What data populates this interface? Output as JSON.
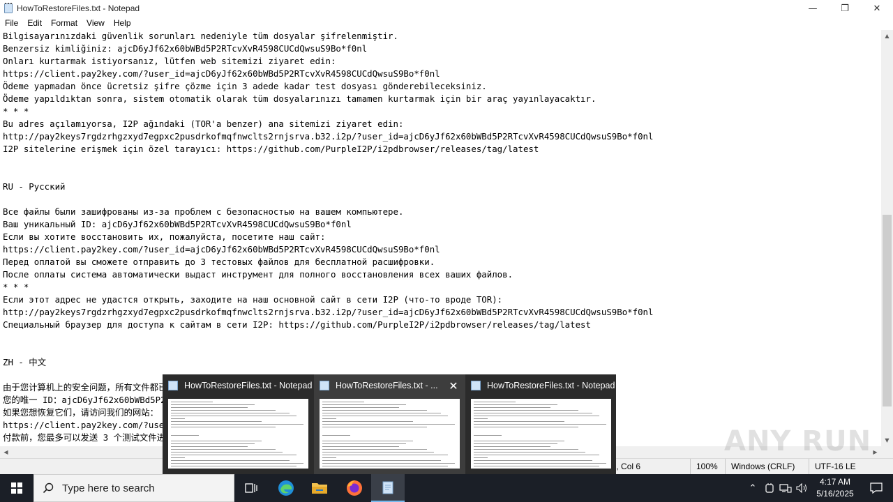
{
  "window": {
    "title": "HowToRestoreFiles.txt - Notepad",
    "minimize_glyph": "—",
    "maximize_glyph": "❐",
    "close_glyph": "✕"
  },
  "menu": [
    "File",
    "Edit",
    "Format",
    "View",
    "Help"
  ],
  "editor_lines": [
    "Bilgisayarınızdaki güvenlik sorunları nedeniyle tüm dosyalar şifrelenmiştir.",
    "Benzersiz kimliğiniz: ajcD6yJf62x60bWBd5P2RTcvXvR4598CUCdQwsuS9Bo*f0nl",
    "Onları kurtarmak istiyorsanız, lütfen web sitemizi ziyaret edin:",
    "https://client.pay2key.com/?user_id=ajcD6yJf62x60bWBd5P2RTcvXvR4598CUCdQwsuS9Bo*f0nl",
    "Ödeme yapmadan önce ücretsiz şifre çözme için 3 adede kadar test dosyası gönderebileceksiniz.",
    "Ödeme yapıldıktan sonra, sistem otomatik olarak tüm dosyalarınızı tamamen kurtarmak için bir araç yayınlayacaktır.",
    "* * *",
    "Bu adres açılamıyorsa, I2P ağındaki (TOR'a benzer) ana sitemizi ziyaret edin:",
    "http://pay2keys7rgdzrhgzxyd7egpxc2pusdrkofmqfnwclts2rnjsrva.b32.i2p/?user_id=ajcD6yJf62x60bWBd5P2RTcvXvR4598CUCdQwsuS9Bo*f0nl",
    "I2P sitelerine erişmek için özel tarayıcı: https://github.com/PurpleI2P/i2pdbrowser/releases/tag/latest",
    "",
    "",
    "RU - Русский",
    "",
    "Все файлы были зашифрованы из-за проблем с безопасностью на вашем компьютере.",
    "Ваш уникальный ID: ajcD6yJf62x60bWBd5P2RTcvXvR4598CUCdQwsuS9Bo*f0nl",
    "Если вы хотите восстановить их, пожалуйста, посетите наш сайт:",
    "https://client.pay2key.com/?user_id=ajcD6yJf62x60bWBd5P2RTcvXvR4598CUCdQwsuS9Bo*f0nl",
    "Перед оплатой вы сможете отправить до 3 тестовых файлов для бесплатной расшифровки.",
    "После оплаты система автоматически выдаст инструмент для полного восстановления всех ваших файлов.",
    "* * *",
    "Если этот адрес не удастся открыть, заходите на наш основной сайт в сети I2P (что-то вроде TOR):",
    "http://pay2keys7rgdzrhgzxyd7egpxc2pusdrkofmqfnwclts2rnjsrva.b32.i2p/?user_id=ajcD6yJf62x60bWBd5P2RTcvXvR4598CUCdQwsuS9Bo*f0nl",
    "Специальный браузер для доступа к сайтам в сети I2P: https://github.com/PurpleI2P/i2pdbrowser/releases/tag/latest",
    "",
    "",
    "ZH - 中文",
    "",
    "由于您计算机上的安全问题，所有文件都已加密。",
    "您的唯一 ID：ajcD6yJf62x60bWBd5P2RTcvXvR4598CUCdQwsuS9Bo*f0nl",
    "如果您想恢复它们，请访问我们的网站：",
    "https://client.pay2key.com/?user_id=ajcD6yJf62x60bWBd5P2RTcvXvR4598CUCdQwsuS9Bo*f0nl",
    "付款前，您最多可以发送 3 个测试文件进行免费解密。"
  ],
  "status": {
    "position": "Ln 6, Col 6",
    "zoom": "100%",
    "line_endings": "Windows (CRLF)",
    "encoding": "UTF-16 LE"
  },
  "watermark": "ANY RUN",
  "thumbnails": [
    {
      "title": "HowToRestoreFiles.txt - Notepad"
    },
    {
      "title": "HowToRestoreFiles.txt - ..."
    },
    {
      "title": "HowToRestoreFiles.txt - Notepad"
    }
  ],
  "thumbnail_close_glyph": "✕",
  "taskbar": {
    "search_placeholder": "Type here to search",
    "time": "4:17 AM",
    "date": "5/16/2025"
  },
  "colors": {
    "taskbar_bg": "#1b1f27",
    "thumb_popup_bg": "#2b2b2b",
    "thumb_active_bg": "#3d3d3d",
    "accent": "#76b9ed"
  }
}
